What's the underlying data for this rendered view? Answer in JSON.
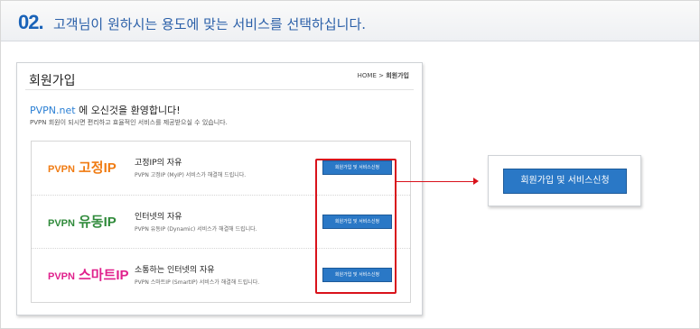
{
  "header": {
    "step_number": "02.",
    "title": "고객님이 원하시는 용도에 맞는 서비스를 선택하십니다."
  },
  "card": {
    "title": "회원가입",
    "breadcrumb": {
      "home": "HOME",
      "separator": ">",
      "current": "회원가입"
    },
    "welcome": {
      "domain": "PVPN.net",
      "rest": " 에 오신것을 환영합니다!"
    },
    "description": "PVPN 회원이 되시면 편리하고 효율적인 서비스를 제공받으실 수 있습니다."
  },
  "services": [
    {
      "brand": "PVPN",
      "kind": "고정IP",
      "color": "#f07b12",
      "name": "고정IP의 자유",
      "desc": "PVPN 고정IP (MyIP) 서비스가 해결해 드립니다.",
      "button": "회원가입 및 서비스신청"
    },
    {
      "brand": "PVPN",
      "kind": "유동IP",
      "color": "#2f8a3a",
      "name": "인터넷의 자유",
      "desc": "PVPN 유동IP (Dynamic) 서비스가 해결해 드립니다.",
      "button": "회원가입 및 서비스신청"
    },
    {
      "brand": "PVPN",
      "kind": "스마트IP",
      "color": "#e0208c",
      "name": "소통하는 인터넷의 자유",
      "desc": "PVPN 스마트IP (SmartIP) 서비스가 해결해 드립니다.",
      "button": "회원가입 및 서비스신청"
    }
  ],
  "callout": {
    "button": "회원가입 및 서비스신청"
  },
  "colors": {
    "accent": "#2a78c6",
    "highlight": "#d9121b",
    "heading": "#1a63b8"
  }
}
